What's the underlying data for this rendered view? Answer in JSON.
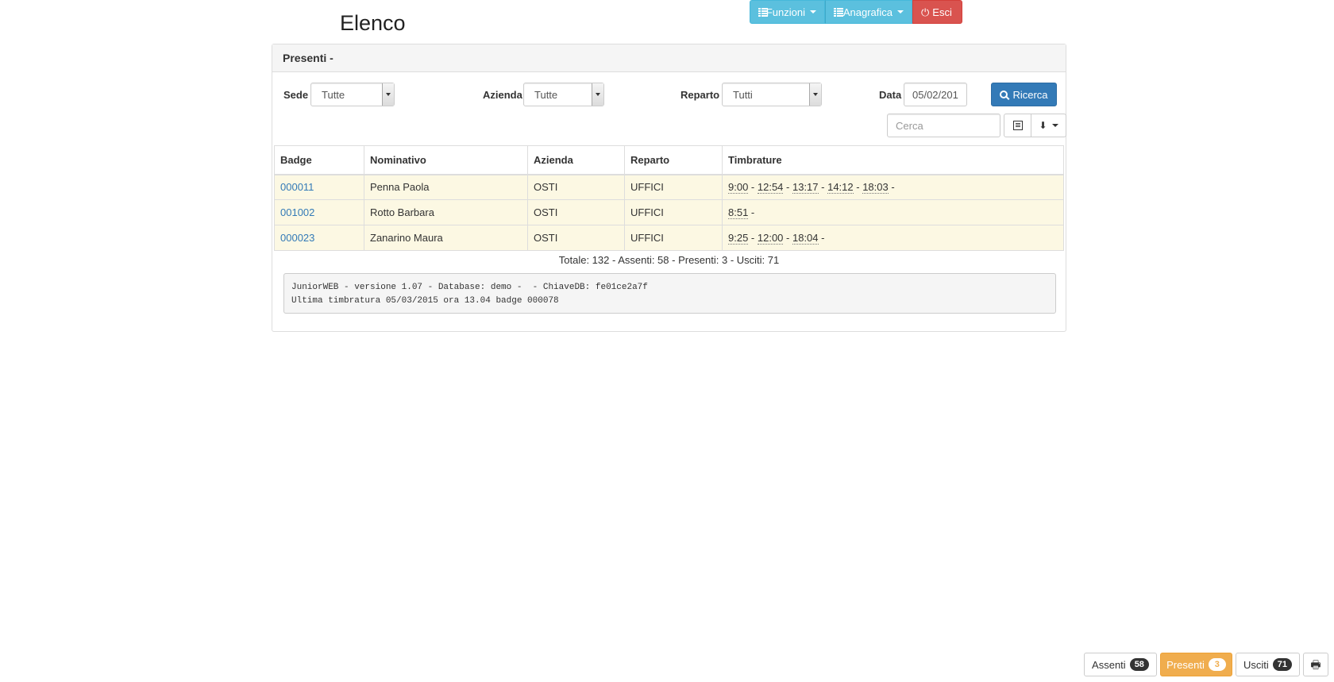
{
  "navbar": {
    "funzioni_label": "Funzioni",
    "anagrafica_label": "Anagrafica",
    "esci_label": "Esci"
  },
  "page": {
    "title": "Elenco"
  },
  "panel": {
    "heading": "Presenti -"
  },
  "filters": {
    "sede": {
      "label": "Sede",
      "value": "Tutte"
    },
    "azienda": {
      "label": "Azienda",
      "value": "Tutte"
    },
    "reparto": {
      "label": "Reparto",
      "value": "Tutti"
    },
    "data": {
      "label": "Data",
      "value": "05/02/201"
    },
    "ricerca_label": "Ricerca",
    "cerca_placeholder": "Cerca"
  },
  "table": {
    "headers": {
      "badge": "Badge",
      "nominativo": "Nominativo",
      "azienda": "Azienda",
      "reparto": "Reparto",
      "timbrature": "Timbrature"
    },
    "rows": [
      {
        "badge": "000011",
        "nominativo": "Penna Paola",
        "azienda": "OSTI",
        "reparto": "UFFICI",
        "timbrature": [
          "9:00",
          "12:54",
          "13:17",
          "14:12",
          "18:03"
        ]
      },
      {
        "badge": "001002",
        "nominativo": "Rotto Barbara",
        "azienda": "OSTI",
        "reparto": "UFFICI",
        "timbrature": [
          "8:51"
        ]
      },
      {
        "badge": "000023",
        "nominativo": "Zanarino Maura",
        "azienda": "OSTI",
        "reparto": "UFFICI",
        "timbrature": [
          "9:25",
          "12:00",
          "18:04"
        ]
      }
    ]
  },
  "summary": "Totale: 132 - Assenti: 58 - Presenti: 3 - Usciti: 71",
  "info": {
    "line1": "JuniorWEB - versione 1.07 - Database: demo -  - ChiaveDB: fe01ce2a7f",
    "line2": "Ultima timbratura 05/03/2015 ora 13.04 badge 000078"
  },
  "footer": {
    "assenti": {
      "label": "Assenti",
      "count": "58"
    },
    "presenti": {
      "label": "Presenti",
      "count": "3"
    },
    "usciti": {
      "label": "Usciti",
      "count": "71"
    }
  },
  "icons": {
    "funzioni": "list-icon",
    "anagrafica": "list-icon",
    "esci": "power-icon",
    "ricerca": "search-icon",
    "columns": "columns-icon",
    "export": "export-icon",
    "print": "print-icon"
  },
  "colors": {
    "info": "#5bc0de",
    "danger": "#d9534f",
    "primary": "#337ab7",
    "warning": "#f0ad4e",
    "row_highlight": "#fcf8e3",
    "link": "#337ab7"
  }
}
